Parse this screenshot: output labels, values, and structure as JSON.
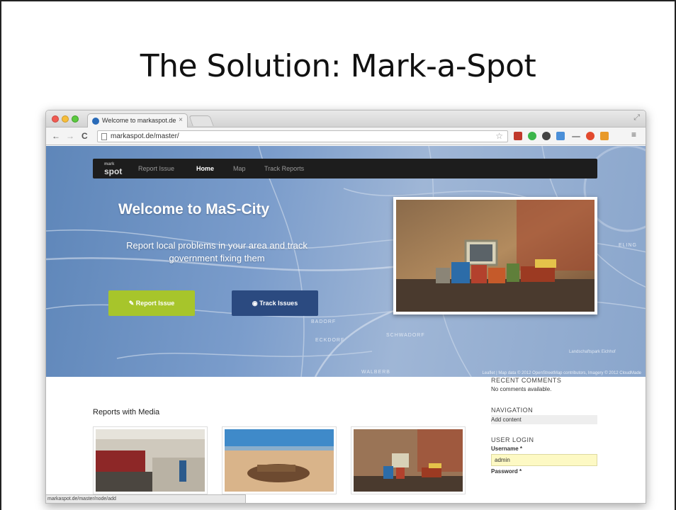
{
  "slide": {
    "title": "The Solution: Mark-a-Spot"
  },
  "browser": {
    "tab_title": "Welcome to markaspot.de",
    "tab_close": "×",
    "url": "markaspot.de/master/",
    "nav": {
      "back": "←",
      "forward": "→",
      "reload": "C"
    },
    "status_url": "markaspot.de/master/node/add"
  },
  "site": {
    "logo_top": "mark",
    "logo_main": "spot",
    "nav": [
      {
        "label": "Report Issue"
      },
      {
        "label": "Home",
        "active": true
      },
      {
        "label": "Map"
      },
      {
        "label": "Track Reports"
      }
    ],
    "welcome": "Welcome to MaS-City",
    "tagline": "Report local problems in your area and track government fixing them",
    "report_button": "Report Issue",
    "track_button": "Track Issues",
    "attribution": "Leaflet | Map data © 2012 OpenStreetMap contributors, Imagery © 2012 CloudMade",
    "map_labels": [
      "SCHWADORF",
      "BADORF",
      "ECKDORF",
      "WALBERB",
      "ELING"
    ],
    "park_label": "Landschaftspark Eichhof"
  },
  "content": {
    "reports_title": "Reports with Media",
    "sidebar": {
      "recent_comments_title": "RECENT COMMENTS",
      "recent_comments_text": "No comments available.",
      "navigation_title": "NAVIGATION",
      "navigation_link": "Add content",
      "login_title": "USER LOGIN",
      "username_label": "Username *",
      "username_value": "admin",
      "password_label": "Password *"
    }
  },
  "colors": {
    "report_button": "#a7c52b",
    "track_button": "#2b4a80",
    "nav_bar": "#1d1d1d",
    "hero_blue": "#7a9ccb"
  }
}
